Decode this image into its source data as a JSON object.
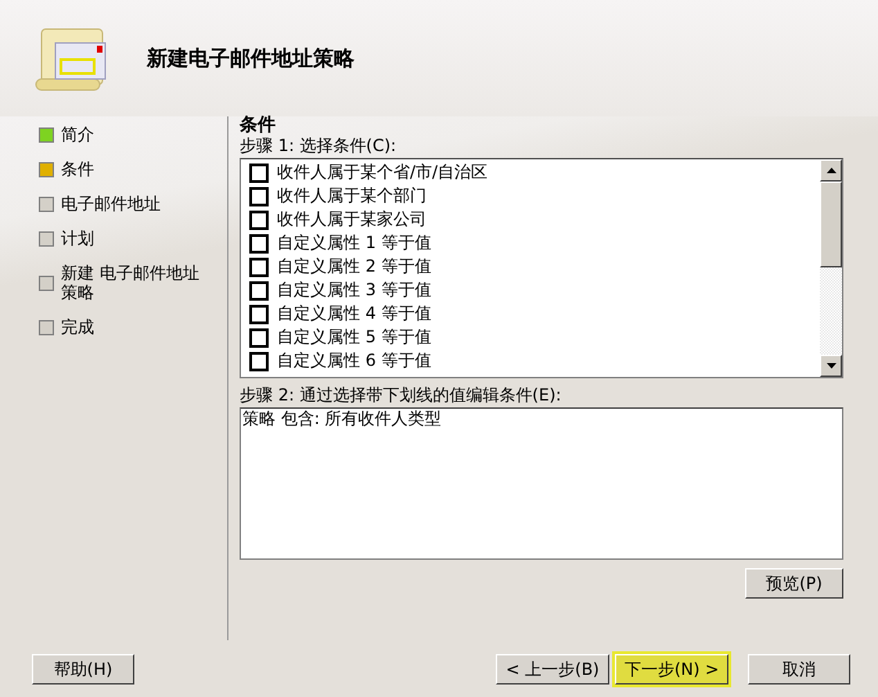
{
  "header": {
    "title": "新建电子邮件地址策略"
  },
  "steps": [
    {
      "label": "简介",
      "color": "#7ed321"
    },
    {
      "label": "条件",
      "color": "#e0b000"
    },
    {
      "label": "电子邮件地址",
      "color": "#d4d0c8"
    },
    {
      "label": "计划",
      "color": "#d4d0c8"
    },
    {
      "label": "新建 电子邮件地址策略",
      "color": "#d4d0c8"
    },
    {
      "label": "完成",
      "color": "#d4d0c8"
    }
  ],
  "section_title": "条件",
  "step1_label": "步骤 1: 选择条件(C):",
  "conditions": [
    {
      "label": "收件人属于某个省/市/自治区",
      "checked": false
    },
    {
      "label": "收件人属于某个部门",
      "checked": false
    },
    {
      "label": "收件人属于某家公司",
      "checked": false
    },
    {
      "label": "自定义属性 1 等于值",
      "checked": false
    },
    {
      "label": "自定义属性 2 等于值",
      "checked": false
    },
    {
      "label": "自定义属性 3 等于值",
      "checked": false
    },
    {
      "label": "自定义属性 4 等于值",
      "checked": false
    },
    {
      "label": "自定义属性 5 等于值",
      "checked": false
    },
    {
      "label": "自定义属性 6 等于值",
      "checked": false
    }
  ],
  "step2_label": "步骤 2: 通过选择带下划线的值编辑条件(E):",
  "step2_text": "策略 包含: 所有收件人类型",
  "preview_button": "预览(P)",
  "buttons": [
    {
      "label": "帮助(H)",
      "kind": "help",
      "selected": false
    },
    {
      "label": "< 上一步(B)",
      "kind": "nav",
      "selected": false
    },
    {
      "label": "下一步(N) >",
      "kind": "nav",
      "selected": true
    },
    {
      "label": "取消",
      "kind": "nav",
      "selected": false
    }
  ]
}
